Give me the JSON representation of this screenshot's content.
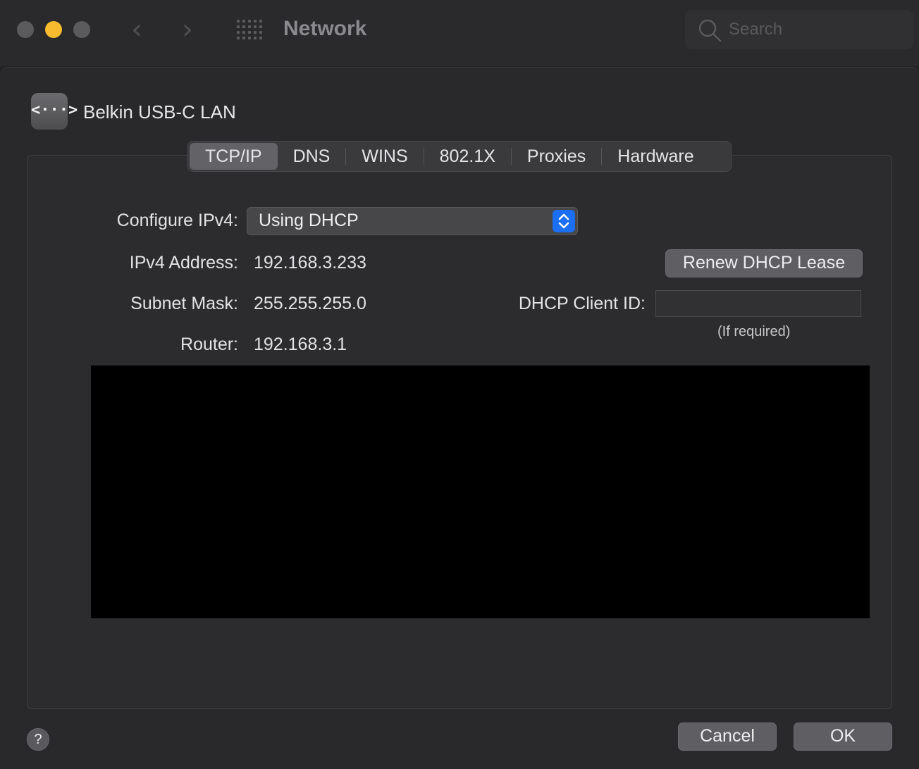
{
  "window": {
    "title": "Network",
    "search_placeholder": "Search"
  },
  "interface": {
    "name": "Belkin USB-C LAN",
    "icon": "ethernet-icon",
    "icon_glyph": "<···>"
  },
  "tabs": [
    {
      "label": "TCP/IP",
      "active": true
    },
    {
      "label": "DNS"
    },
    {
      "label": "WINS"
    },
    {
      "label": "802.1X"
    },
    {
      "label": "Proxies"
    },
    {
      "label": "Hardware"
    }
  ],
  "tcpip": {
    "configure_label": "Configure IPv4:",
    "configure_value": "Using DHCP",
    "ipv4_label": "IPv4 Address:",
    "ipv4_value": "192.168.3.233",
    "subnet_label": "Subnet Mask:",
    "subnet_value": "255.255.255.0",
    "router_label": "Router:",
    "router_value": "192.168.3.1",
    "renew_button": "Renew DHCP Lease",
    "client_id_label": "DHCP Client ID:",
    "client_id_value": "",
    "client_id_hint": "(If required)"
  },
  "footer": {
    "help": "?",
    "cancel": "Cancel",
    "ok": "OK"
  },
  "colors": {
    "accent": "#1c6ef2",
    "minimize": "#f8bb30"
  }
}
